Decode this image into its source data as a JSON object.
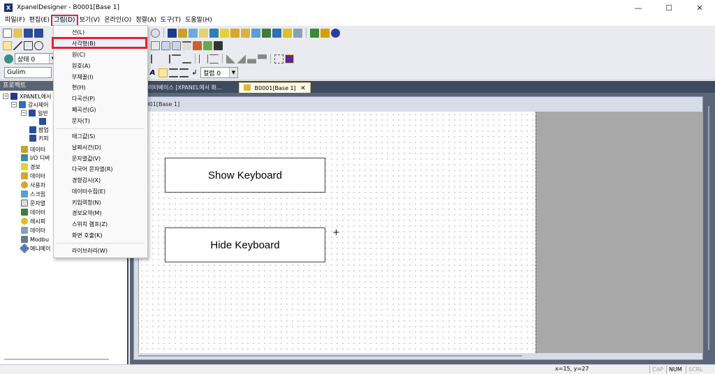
{
  "window": {
    "title": "XpanelDesigner - B0001[Base 1]",
    "controls": {
      "minimize": "—",
      "maximize": "☐",
      "close": "✕"
    }
  },
  "menubar": [
    "파일(F)",
    "편집(E)",
    "그림(D)",
    "보기(V)",
    "온라인(O)",
    "정렬(A)",
    "도구(T)",
    "도움말(H)"
  ],
  "toolbar": {
    "state_combo": "상태 0",
    "font_combo": "Gulim",
    "column_combo": "컬럼 0"
  },
  "project_panel": {
    "header": "프로젝트",
    "items": [
      "XPANEL에서",
      "감시제어",
      "일반",
      "팝업",
      "키피",
      "데이터",
      "I/O 디바",
      "경보",
      "데이터",
      "사용자",
      "스크립",
      "문자열",
      "데이터",
      "레시피",
      "데이터",
      "Modbu",
      "애니메이"
    ]
  },
  "tabs": [
    {
      "label": "이터베이스 [XPANEL에서 화..."
    },
    {
      "label": "B0001[Base 1]",
      "close": "✕"
    }
  ],
  "document": {
    "frame_label": "B0001[Base 1]",
    "buttons": [
      "Show Keyboard",
      "Hide Keyboard"
    ],
    "cursor_glyph": "+"
  },
  "dropdown": {
    "items": [
      "선(L)",
      "사각형(B)",
      "원(C)",
      "원호(A)",
      "부채꼴(I)",
      "현(H)",
      "다곡선(P)",
      "폐곡선(G)",
      "문자(T)",
      "태그값(S)",
      "날짜시간(D)",
      "문자열값(V)",
      "다국어 문자열(R)",
      "경향감시(X)",
      "데이터수집(E)",
      "키입력창(N)",
      "경보요약(M)",
      "스위치 램프(Z)",
      "화면 호출(K)",
      "라이브러리(W)"
    ],
    "highlighted": "사각형(B)"
  },
  "statusbar": {
    "coords": "x=15, y=27",
    "cap": "CAP",
    "num": "NUM",
    "scrl": "SCRL"
  }
}
